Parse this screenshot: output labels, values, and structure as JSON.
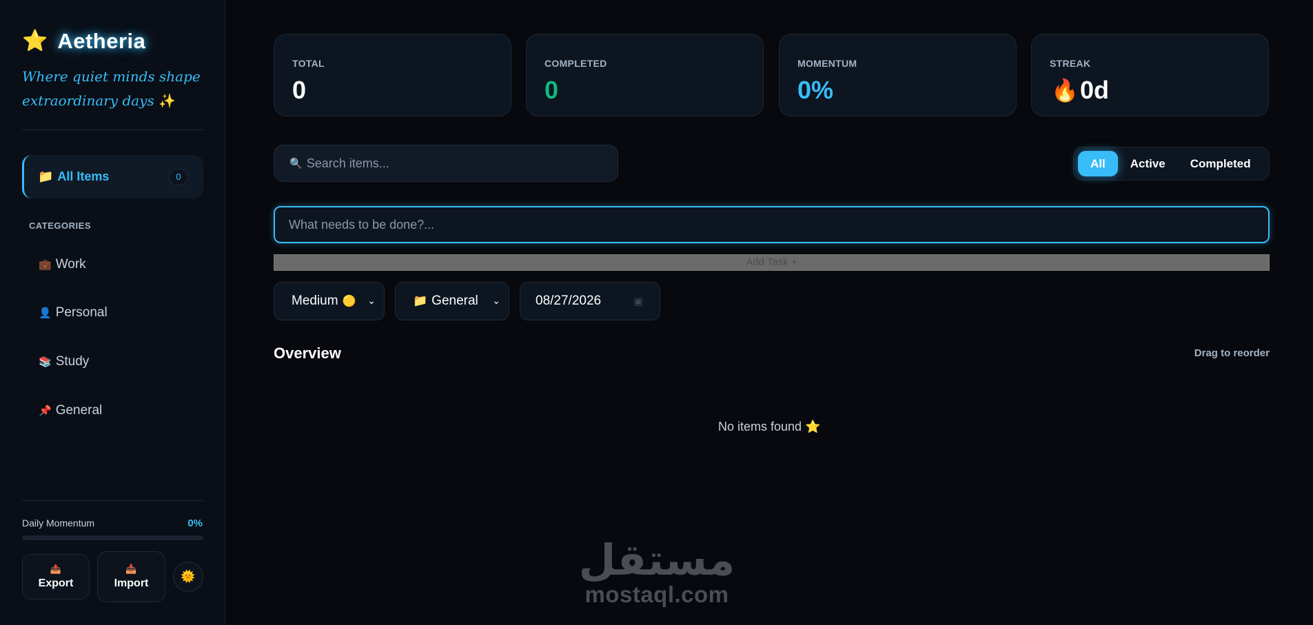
{
  "brand": {
    "title": "Aetheria",
    "star_icon": "⭐",
    "tagline": "Where quiet minds shape extraordinary days",
    "tagline_sparkle": "✨"
  },
  "nav": {
    "all_items": {
      "icon": "📁",
      "label": "All Items",
      "count": "0"
    },
    "categories_heading": "CATEGORIES",
    "categories": [
      {
        "icon": "💼",
        "label": "Work"
      },
      {
        "icon": "👤",
        "label": "Personal"
      },
      {
        "icon": "📚",
        "label": "Study"
      },
      {
        "icon": "📌",
        "label": "General"
      }
    ]
  },
  "momentum": {
    "label": "Daily Momentum",
    "value": "0%",
    "fraction": 0
  },
  "actions": {
    "export": {
      "icon": "📤",
      "label": "Export"
    },
    "import": {
      "icon": "📥",
      "label": "Import"
    },
    "theme_icon": "🌞"
  },
  "stats": [
    {
      "label": "TOTAL",
      "value": "0",
      "color": "#ffffff"
    },
    {
      "label": "COMPLETED",
      "value": "0",
      "color": "#10b981"
    },
    {
      "label": "MOMENTUM",
      "value": "0%",
      "color": "#38bdf8"
    },
    {
      "label": "STREAK",
      "value": "0d",
      "color": "#ffffff",
      "icon": "🔥"
    }
  ],
  "search": {
    "icon": "🔍",
    "placeholder": "Search items..."
  },
  "filters": [
    "All",
    "Active",
    "Completed"
  ],
  "task": {
    "placeholder": "What needs to be done?...",
    "add_label": "Add Task +"
  },
  "selects": {
    "priority": {
      "value": "Medium",
      "icon": "🟡"
    },
    "category": {
      "value": "General",
      "icon": "📁"
    },
    "date": {
      "value": "08/27/2026"
    }
  },
  "list": {
    "title": "Overview",
    "hint": "Drag to reorder",
    "empty_text": "No items found",
    "empty_icon": "⭐"
  },
  "watermark": {
    "arabic": "مستقل",
    "latin": "mostaql.com"
  },
  "colors": {
    "accent": "#38bdf8",
    "success": "#10b981",
    "background": "#07090e",
    "card": "#0d1520"
  }
}
